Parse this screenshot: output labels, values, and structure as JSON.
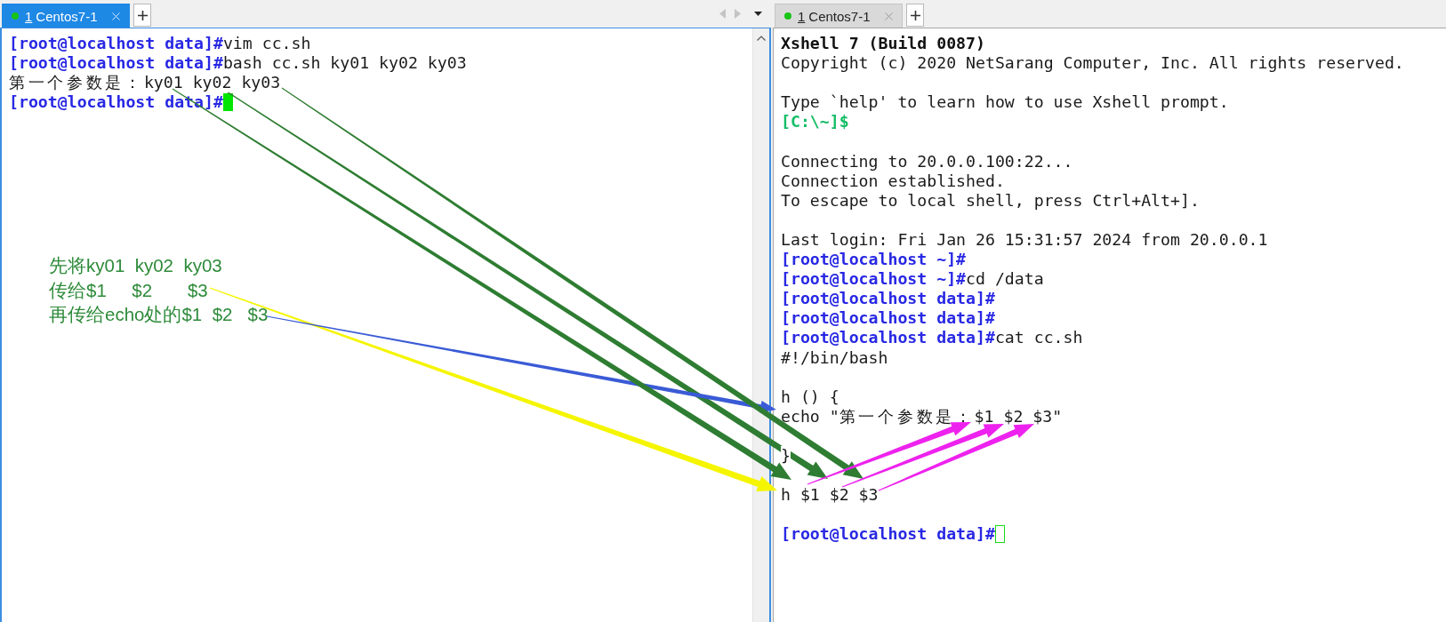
{
  "panes": [
    {
      "tabs": [
        {
          "number": "1",
          "label": "Centos7-1",
          "selected": true,
          "connected": true
        }
      ],
      "tab_nav": true,
      "focused": true,
      "scrollbar": true,
      "terminal": {
        "lines": [
          {
            "kind": "text",
            "parts": [
              {
                "kind": "prompt",
                "text": "[root@localhost data]#"
              },
              {
                "kind": "output",
                "text": "vim cc.sh"
              }
            ]
          },
          {
            "kind": "text",
            "parts": [
              {
                "kind": "prompt",
                "text": "[root@localhost data]#"
              },
              {
                "kind": "output",
                "text": "bash cc.sh ky01 ky02 ky03"
              }
            ]
          },
          {
            "kind": "text",
            "parts": [
              {
                "kind": "output",
                "text": "第一个参数是：ky01 ky02 ky03"
              }
            ]
          },
          {
            "kind": "text",
            "parts": [
              {
                "kind": "prompt",
                "text": "[root@localhost data]#"
              }
            ],
            "cursor": {
              "focused": true
            }
          }
        ]
      },
      "annotation": [
        "先将ky01  ky02  ky03",
        "传给$1     $2       $3",
        "再传给echo处的$1  $2   $3"
      ]
    },
    {
      "tabs": [
        {
          "number": "1",
          "label": "Centos7-1",
          "selected": false,
          "connected": true
        }
      ],
      "tab_nav": false,
      "focused": false,
      "scrollbar": false,
      "terminal": {
        "lines": [
          {
            "kind": "text",
            "parts": [
              {
                "kind": "heading",
                "text": "Xshell 7 (Build 0087)"
              }
            ]
          },
          {
            "kind": "text",
            "parts": [
              {
                "kind": "output",
                "text": "Copyright (c) 2020 NetSarang Computer, Inc. All rights reserved."
              }
            ]
          },
          {
            "kind": "blank"
          },
          {
            "kind": "text",
            "parts": [
              {
                "kind": "output",
                "text": "Type `help' to learn how to use Xshell prompt."
              }
            ]
          },
          {
            "kind": "text",
            "parts": [
              {
                "kind": "local_prompt",
                "text": "[C:\\~]$"
              }
            ]
          },
          {
            "kind": "blank"
          },
          {
            "kind": "text",
            "parts": [
              {
                "kind": "output",
                "text": "Connecting to 20.0.0.100:22..."
              }
            ]
          },
          {
            "kind": "text",
            "parts": [
              {
                "kind": "output",
                "text": "Connection established."
              }
            ]
          },
          {
            "kind": "text",
            "parts": [
              {
                "kind": "output",
                "text": "To escape to local shell, press Ctrl+Alt+]."
              }
            ]
          },
          {
            "kind": "blank"
          },
          {
            "kind": "text",
            "parts": [
              {
                "kind": "output",
                "text": "Last login: Fri Jan 26 15:31:57 2024 from 20.0.0.1"
              }
            ]
          },
          {
            "kind": "text",
            "parts": [
              {
                "kind": "prompt",
                "text": "[root@localhost ~]#"
              }
            ]
          },
          {
            "kind": "text",
            "parts": [
              {
                "kind": "prompt",
                "text": "[root@localhost ~]#"
              },
              {
                "kind": "output",
                "text": "cd /data"
              }
            ]
          },
          {
            "kind": "text",
            "parts": [
              {
                "kind": "prompt",
                "text": "[root@localhost data]#"
              }
            ]
          },
          {
            "kind": "text",
            "parts": [
              {
                "kind": "prompt",
                "text": "[root@localhost data]#"
              }
            ]
          },
          {
            "kind": "text",
            "parts": [
              {
                "kind": "prompt",
                "text": "[root@localhost data]#"
              },
              {
                "kind": "output",
                "text": "cat cc.sh"
              }
            ]
          },
          {
            "kind": "text",
            "parts": [
              {
                "kind": "output",
                "text": "#!/bin/bash"
              }
            ]
          },
          {
            "kind": "blank"
          },
          {
            "kind": "text",
            "parts": [
              {
                "kind": "output",
                "text": "h () {"
              }
            ]
          },
          {
            "kind": "text",
            "parts": [
              {
                "kind": "output",
                "text": "echo \"第一个参数是：$1 $2 $3\""
              }
            ]
          },
          {
            "kind": "blank"
          },
          {
            "kind": "text",
            "parts": [
              {
                "kind": "output",
                "text": "}"
              }
            ]
          },
          {
            "kind": "blank"
          },
          {
            "kind": "text",
            "parts": [
              {
                "kind": "output",
                "text": "h $1 $2 $3"
              }
            ]
          },
          {
            "kind": "blank"
          },
          {
            "kind": "text",
            "parts": [
              {
                "kind": "prompt",
                "text": "[root@localhost data]#"
              }
            ],
            "cursor": {
              "focused": false
            }
          }
        ]
      }
    }
  ]
}
